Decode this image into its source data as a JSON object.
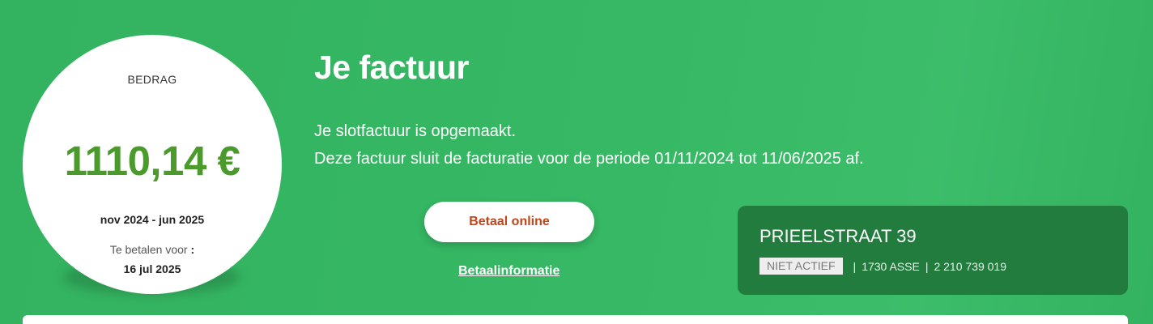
{
  "amount_card": {
    "label": "BEDRAG",
    "amount": "1110,14 €",
    "period": "nov 2024 - jun 2025",
    "due_label": "Te betalen voor",
    "due_colon": ":",
    "due_date": "16 jul 2025"
  },
  "invoice": {
    "title": "Je factuur",
    "line1": "Je slotfactuur is opgemaakt.",
    "line2": "Deze factuur sluit de facturatie voor de periode 01/11/2024 tot 11/06/2025 af."
  },
  "actions": {
    "pay_button": "Betaal online",
    "pay_info_link": "Betaalinformatie"
  },
  "address": {
    "street": "PRIEELSTRAAT 39",
    "status": "NIET ACTIEF",
    "separator": "|",
    "city": "1730 ASSE",
    "number": "2 210 739 019"
  },
  "colors": {
    "background": "#36b864",
    "amount": "#4a9a2c",
    "pay_button_text": "#c0461b",
    "address_card": "#227c3e"
  }
}
